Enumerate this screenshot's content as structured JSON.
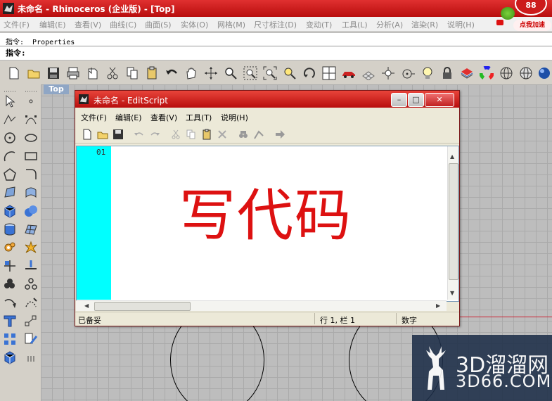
{
  "app": {
    "title": "未命名 - Rhinoceros (企业版) - [Top]",
    "accent": "#c61616"
  },
  "menu": [
    "文件(F)",
    "编辑(E)",
    "查看(V)",
    "曲线(C)",
    "曲面(S)",
    "实体(O)",
    "网格(M)",
    "尺寸标注(D)",
    "变动(T)",
    "工具(L)",
    "分析(A)",
    "渲染(R)",
    "说明(H)"
  ],
  "badge": {
    "count": "88",
    "boost": "点我加速"
  },
  "command": {
    "history": "指令: _Properties",
    "prompt": "指令:"
  },
  "toolbar_icons": [
    "new-file-icon",
    "open-file-icon",
    "save-icon",
    "print-icon",
    "import-icon",
    "cut-icon",
    "copy-icon",
    "paste-icon",
    "clipboard-icon",
    "undo-icon",
    "pan-hand-icon",
    "rotate-view-icon",
    "zoom-icon",
    "zoom-window-icon",
    "zoom-extents-icon",
    "zoom-selected-icon",
    "rotate-icon",
    "four-viewports-icon",
    "car-render-icon",
    "grid-icon",
    "snap-icon",
    "osnap-icon",
    "light-icon",
    "lock-icon",
    "layer-icon",
    "color-wheel-icon",
    "wireframe-icon",
    "shaded-icon",
    "rendered-sphere-icon"
  ],
  "viewport": {
    "label": "Top"
  },
  "editscript": {
    "title": "未命名 - EditScript",
    "menu": [
      "文件(F)",
      "编辑(E)",
      "查看(V)",
      "工具(T)",
      "说明(H)"
    ],
    "line_number": "01",
    "content": "写代码",
    "status": {
      "left": "已备妥",
      "position": "行 1, 栏 1",
      "mode": "数字"
    }
  },
  "watermark": {
    "line1": "3D溜溜网",
    "line2": "3D66.COM"
  }
}
